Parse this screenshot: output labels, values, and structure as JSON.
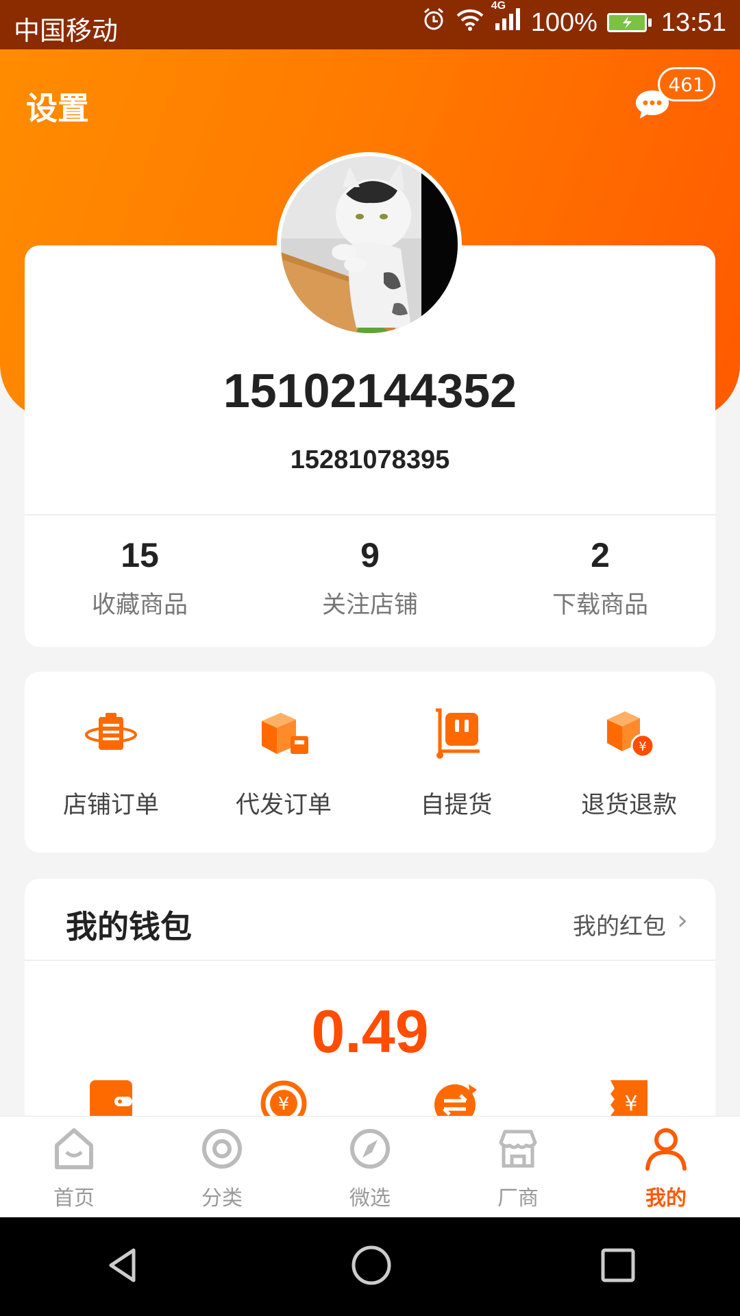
{
  "status_bar": {
    "carrier": "中国移动",
    "network": "4G",
    "battery": "100%",
    "time": "13:51",
    "icons": [
      "alarm-icon",
      "wifi-icon",
      "signal-icon",
      "battery-charging-icon"
    ]
  },
  "header": {
    "settings_label": "设置",
    "message_count": "461",
    "gradient_colors": [
      "#ff8c00",
      "#ff5a00"
    ]
  },
  "profile": {
    "username": "15102144352",
    "phone": "15281078395",
    "stats": [
      {
        "value": "15",
        "label": "收藏商品"
      },
      {
        "value": "9",
        "label": "关注店铺"
      },
      {
        "value": "2",
        "label": "下载商品"
      }
    ]
  },
  "orders": [
    {
      "label": "店铺订单",
      "icon": "store-order-icon"
    },
    {
      "label": "代发订单",
      "icon": "dropship-order-icon"
    },
    {
      "label": "自提货",
      "icon": "self-pickup-icon"
    },
    {
      "label": "退货退款",
      "icon": "refund-icon"
    }
  ],
  "wallet": {
    "title": "我的钱包",
    "red_packet_label": "我的红包",
    "balance": "0.49",
    "icons": [
      "wallet-icon",
      "yuan-exchange-icon",
      "transfer-icon",
      "bill-icon"
    ]
  },
  "tabs": [
    {
      "label": "首页",
      "icon": "home-icon",
      "active": false
    },
    {
      "label": "分类",
      "icon": "category-icon",
      "active": false
    },
    {
      "label": "微选",
      "icon": "compass-icon",
      "active": false
    },
    {
      "label": "厂商",
      "icon": "shop-icon",
      "active": false
    },
    {
      "label": "我的",
      "icon": "profile-icon",
      "active": true
    }
  ],
  "colors": {
    "accent": "#ff5a00",
    "status_bar": "#8a2b00"
  }
}
